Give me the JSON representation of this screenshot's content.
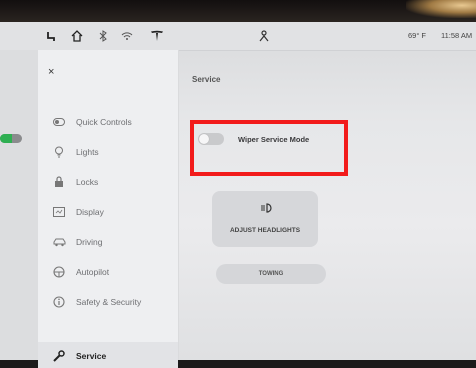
{
  "status_bar": {
    "temperature": "69° F",
    "time": "11:58 AM"
  },
  "sidebar": {
    "close_label": "×",
    "items": [
      {
        "label": "Quick Controls",
        "icon": "toggle-icon"
      },
      {
        "label": "Lights",
        "icon": "bulb-icon"
      },
      {
        "label": "Locks",
        "icon": "lock-icon"
      },
      {
        "label": "Display",
        "icon": "display-icon"
      },
      {
        "label": "Driving",
        "icon": "car-icon"
      },
      {
        "label": "Autopilot",
        "icon": "steering-wheel-icon"
      },
      {
        "label": "Safety & Security",
        "icon": "info-circle-icon"
      },
      {
        "label": "Service",
        "icon": "wrench-icon",
        "active": true
      }
    ]
  },
  "main": {
    "title": "Service",
    "wiper_service_mode": {
      "label": "Wiper Service Mode",
      "on": false
    },
    "adjust_headlights_label": "ADJUST HEADLIGHTS",
    "towing_label": "TOWING"
  },
  "colors": {
    "highlight": "#f21b1b",
    "battery_green": "#2faf52"
  }
}
